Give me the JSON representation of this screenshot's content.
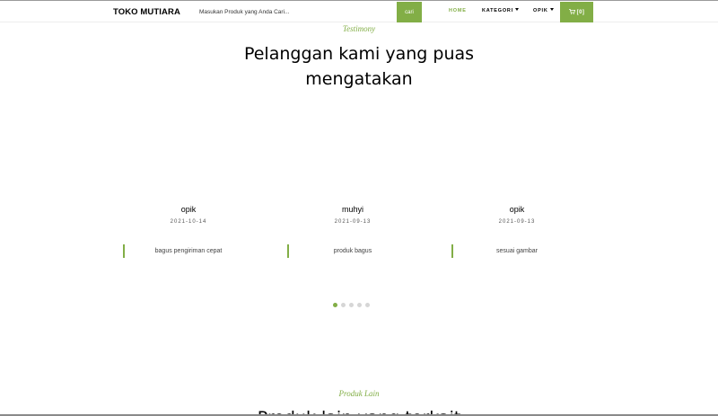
{
  "header": {
    "brand": "TOKO MUTIARA",
    "search_placeholder": "Masukan Produk yang Anda Cari...",
    "search_button": "cari",
    "nav": {
      "home": "HOME",
      "kategori": "KATEGORI",
      "user": "OPIK"
    },
    "cart": "[0]"
  },
  "testimony": {
    "subheading": "Testimony",
    "title_line1": "Pelanggan kami yang puas",
    "title_line2": "mengatakan",
    "items": [
      {
        "name": "opik",
        "date": "2021-10-14",
        "quote": "bagus pengiriman cepat"
      },
      {
        "name": "muhyi",
        "date": "2021-09-13",
        "quote": "produk bagus"
      },
      {
        "name": "opik",
        "date": "2021-09-13",
        "quote": "sesuai gambar"
      }
    ],
    "carousel_pages": 5,
    "carousel_active": 1
  },
  "produk_lain": {
    "subheading": "Produk Lain",
    "title": "Produk lain yang terkait"
  },
  "colors": {
    "accent": "#82ae46"
  }
}
